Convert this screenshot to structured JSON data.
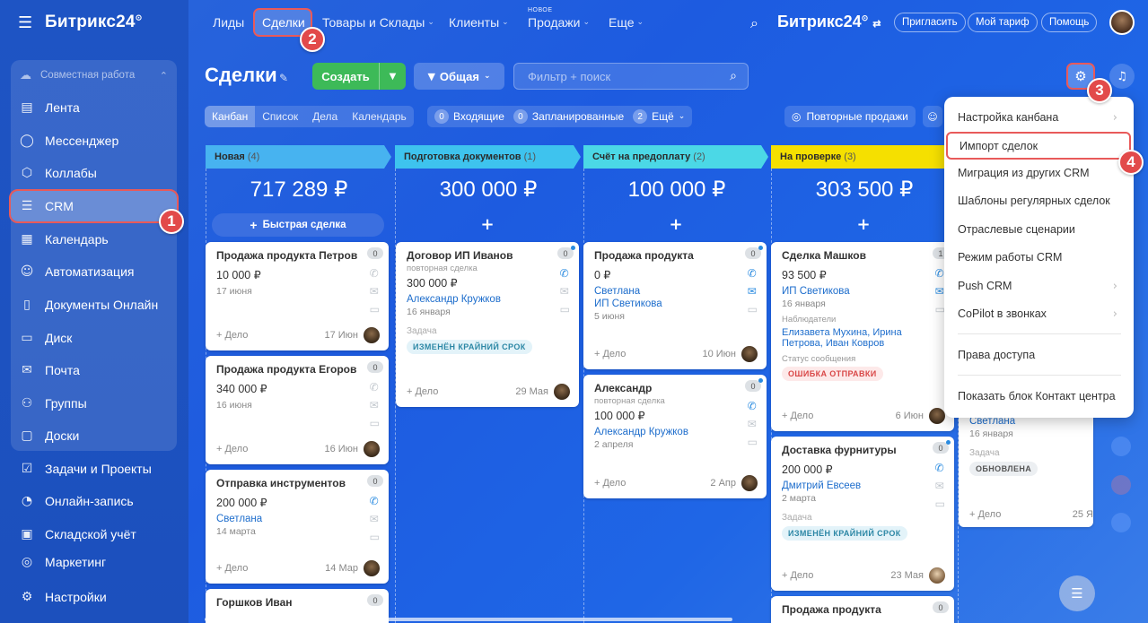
{
  "sidebar": {
    "logo": "Битрикс24",
    "logo_sup": "⊙",
    "group_title": "Совместная работа",
    "items": [
      {
        "label": "Лента",
        "icon": "feed-icon",
        "glyph": "▤"
      },
      {
        "label": "Мессенджер",
        "icon": "chat-icon",
        "glyph": "◯"
      },
      {
        "label": "Коллабы",
        "icon": "collab-icon",
        "glyph": "⬡"
      },
      {
        "label": "CRM",
        "icon": "crm-icon",
        "glyph": "☰"
      },
      {
        "label": "Календарь",
        "icon": "calendar-icon",
        "glyph": "▦"
      },
      {
        "label": "Автоматизация",
        "icon": "robot-icon",
        "glyph": "☺"
      },
      {
        "label": "Документы Онлайн",
        "icon": "document-icon",
        "glyph": "▯"
      },
      {
        "label": "Диск",
        "icon": "disk-icon",
        "glyph": "▭"
      },
      {
        "label": "Почта",
        "icon": "mail-icon",
        "glyph": "✉"
      },
      {
        "label": "Группы",
        "icon": "groups-icon",
        "glyph": "⚇"
      },
      {
        "label": "Доски",
        "icon": "boards-icon",
        "glyph": "▢"
      },
      {
        "label": "Задачи и Проекты",
        "icon": "tasks-icon",
        "glyph": "☑"
      },
      {
        "label": "Онлайн-запись",
        "icon": "booking-icon",
        "glyph": "◔"
      },
      {
        "label": "Складской учёт",
        "icon": "warehouse-icon",
        "glyph": "▣"
      },
      {
        "label": "Маркетинг",
        "icon": "marketing-icon",
        "glyph": "◎"
      }
    ],
    "settings": "Настройки"
  },
  "topnav": {
    "leads": "Лиды",
    "deals": "Сделки",
    "goods": "Товары и Склады",
    "clients": "Клиенты",
    "sales_new": "НОВОЕ",
    "sales": "Продажи",
    "more": "Еще",
    "logo": "Битрикс24",
    "invite": "Пригласить",
    "tariff": "Мой тариф",
    "help": "Помощь"
  },
  "toolbar": {
    "title": "Сделки",
    "create": "Создать",
    "general": "Общая",
    "filter_placeholder": "Фильтр + поиск"
  },
  "views": [
    "Канбан",
    "Список",
    "Дела",
    "Календарь"
  ],
  "counters": [
    {
      "n": "0",
      "label": "Входящие"
    },
    {
      "n": "0",
      "label": "Запланированные"
    },
    {
      "n": "2",
      "label": "Ещё"
    }
  ],
  "repeat_sales": "Повторные продажи",
  "columns": [
    {
      "name": "Новая",
      "count": "(4)",
      "sum": "717 289 ₽",
      "color": "#47b3f0"
    },
    {
      "name": "Подготовка документов",
      "count": "(1)",
      "sum": "300 000 ₽",
      "color": "#3ec3ee"
    },
    {
      "name": "Счёт на предоплату",
      "count": "(2)",
      "sum": "100 000 ₽",
      "color": "#4bd8e6"
    },
    {
      "name": "На проверке",
      "count": "(3)",
      "sum": "303 500 ₽",
      "color": "#f5e000"
    }
  ],
  "quick_deal": "Быстрая сделка",
  "cards": {
    "c1": {
      "title": "Продажа продукта Петров",
      "price": "10 000 ₽",
      "date": "17 июня",
      "add": "+ Дело",
      "fdate": "17 Июн",
      "count": "0"
    },
    "c2": {
      "title": "Продажа продукта Егоров",
      "price": "340 000 ₽",
      "date": "16 июня",
      "add": "+ Дело",
      "fdate": "16 Июн",
      "count": "0"
    },
    "c3": {
      "title": "Отправка инструментов",
      "price": "200 000 ₽",
      "link": "Светлана",
      "date": "14 марта",
      "add": "+ Дело",
      "fdate": "14 Мар",
      "count": "0"
    },
    "c4": {
      "title": "Горшков Иван",
      "count": "0"
    },
    "c5": {
      "title": "Договор ИП Иванов",
      "sub": "повторная сделка",
      "price": "300 000 ₽",
      "link": "Александр Кружков",
      "date": "16 января",
      "task": "Задача",
      "tag": "ИЗМЕНЁН КРАЙНИЙ СРОК",
      "add": "+ Дело",
      "fdate": "29 Мая",
      "count": "0"
    },
    "c6": {
      "title": "Продажа продукта",
      "price": "0 ₽",
      "link": "Светлана",
      "link2": "ИП Светикова",
      "date": "5 июня",
      "add": "+ Дело",
      "fdate": "10 Июн",
      "count": "0"
    },
    "c7": {
      "title": "Александр",
      "sub": "повторная сделка",
      "price": "100 000 ₽",
      "link": "Александр Кружков",
      "date": "2 апреля",
      "add": "+ Дело",
      "fdate": "2 Апр",
      "count": "0"
    },
    "c8": {
      "title": "Сделка Машков",
      "price": "93 500 ₽",
      "link": "ИП Светикова",
      "date": "16 января",
      "obs": "Наблюдатели",
      "obs_names": "Елизавета Мухина, Ирина Петрова, Иван Ковров",
      "status": "Статус сообщения",
      "tag": "ОШИБКА ОТПРАВКИ",
      "add": "+ Дело",
      "fdate": "6 Июн",
      "count": "1"
    },
    "c9": {
      "title": "Доставка фурнитуры",
      "price": "200 000 ₽",
      "link": "Дмитрий Евсеев",
      "date": "2 марта",
      "task": "Задача",
      "tag": "ИЗМЕНЁН КРАЙНИЙ СРОК",
      "add": "+ Дело",
      "fdate": "23 Мая",
      "count": "0"
    },
    "c10": {
      "title": "Продажа продукта",
      "count": "0"
    },
    "c11": {
      "link": "Светлана",
      "date": "16 января",
      "task": "Задача",
      "tag": "ОБНОВЛЕНА",
      "add": "+ Дело",
      "fdate": "25 Я"
    }
  },
  "menu": {
    "items": [
      "Настройка канбана",
      "Импорт сделок",
      "Миграция из других CRM",
      "Шаблоны регулярных сделок",
      "Отраслевые сценарии",
      "Режим работы CRM",
      "Push CRM",
      "CoPilot в звонках",
      "Права доступа",
      "Показать блок Контакт центра"
    ]
  },
  "steps": [
    "1",
    "2",
    "3",
    "4"
  ]
}
